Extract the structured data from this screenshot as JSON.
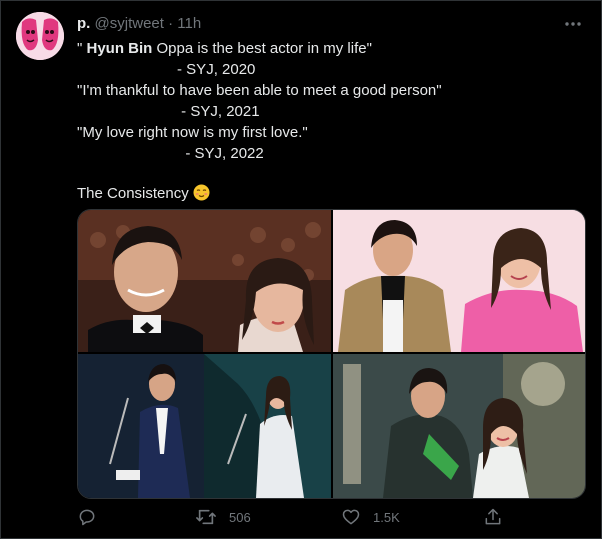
{
  "tweet": {
    "display_name": "p.",
    "handle": "@syjtweet",
    "separator": "·",
    "time": "11h",
    "lines": [
      {
        "prefix": "\" ",
        "bold": "Hyun Bin",
        "suffix": " Oppa is the best actor in my life\""
      },
      {
        "text": "                        - SYJ, 2020"
      },
      {
        "text": "\"I'm thankful to have been able to meet a good person\""
      },
      {
        "text": "                         - SYJ, 2021"
      },
      {
        "text": "\"My love right now is my first love.\""
      },
      {
        "text": "                          - SYJ, 2022"
      }
    ],
    "closing": "The Consistency"
  },
  "icons": {
    "more": "more-options-icon",
    "emoji": "smiling-face-emoji-icon",
    "reply": "reply-icon",
    "retweet": "retweet-icon",
    "like": "heart-icon",
    "share": "share-icon"
  },
  "media": {
    "photo_count": 4
  },
  "actions": {
    "reply_count": "",
    "retweet_count": "506",
    "like_count": "1.5K"
  },
  "colors": {
    "background": "#000000",
    "text": "#e7e9ea",
    "muted": "#71767b",
    "border": "#2f3336"
  }
}
